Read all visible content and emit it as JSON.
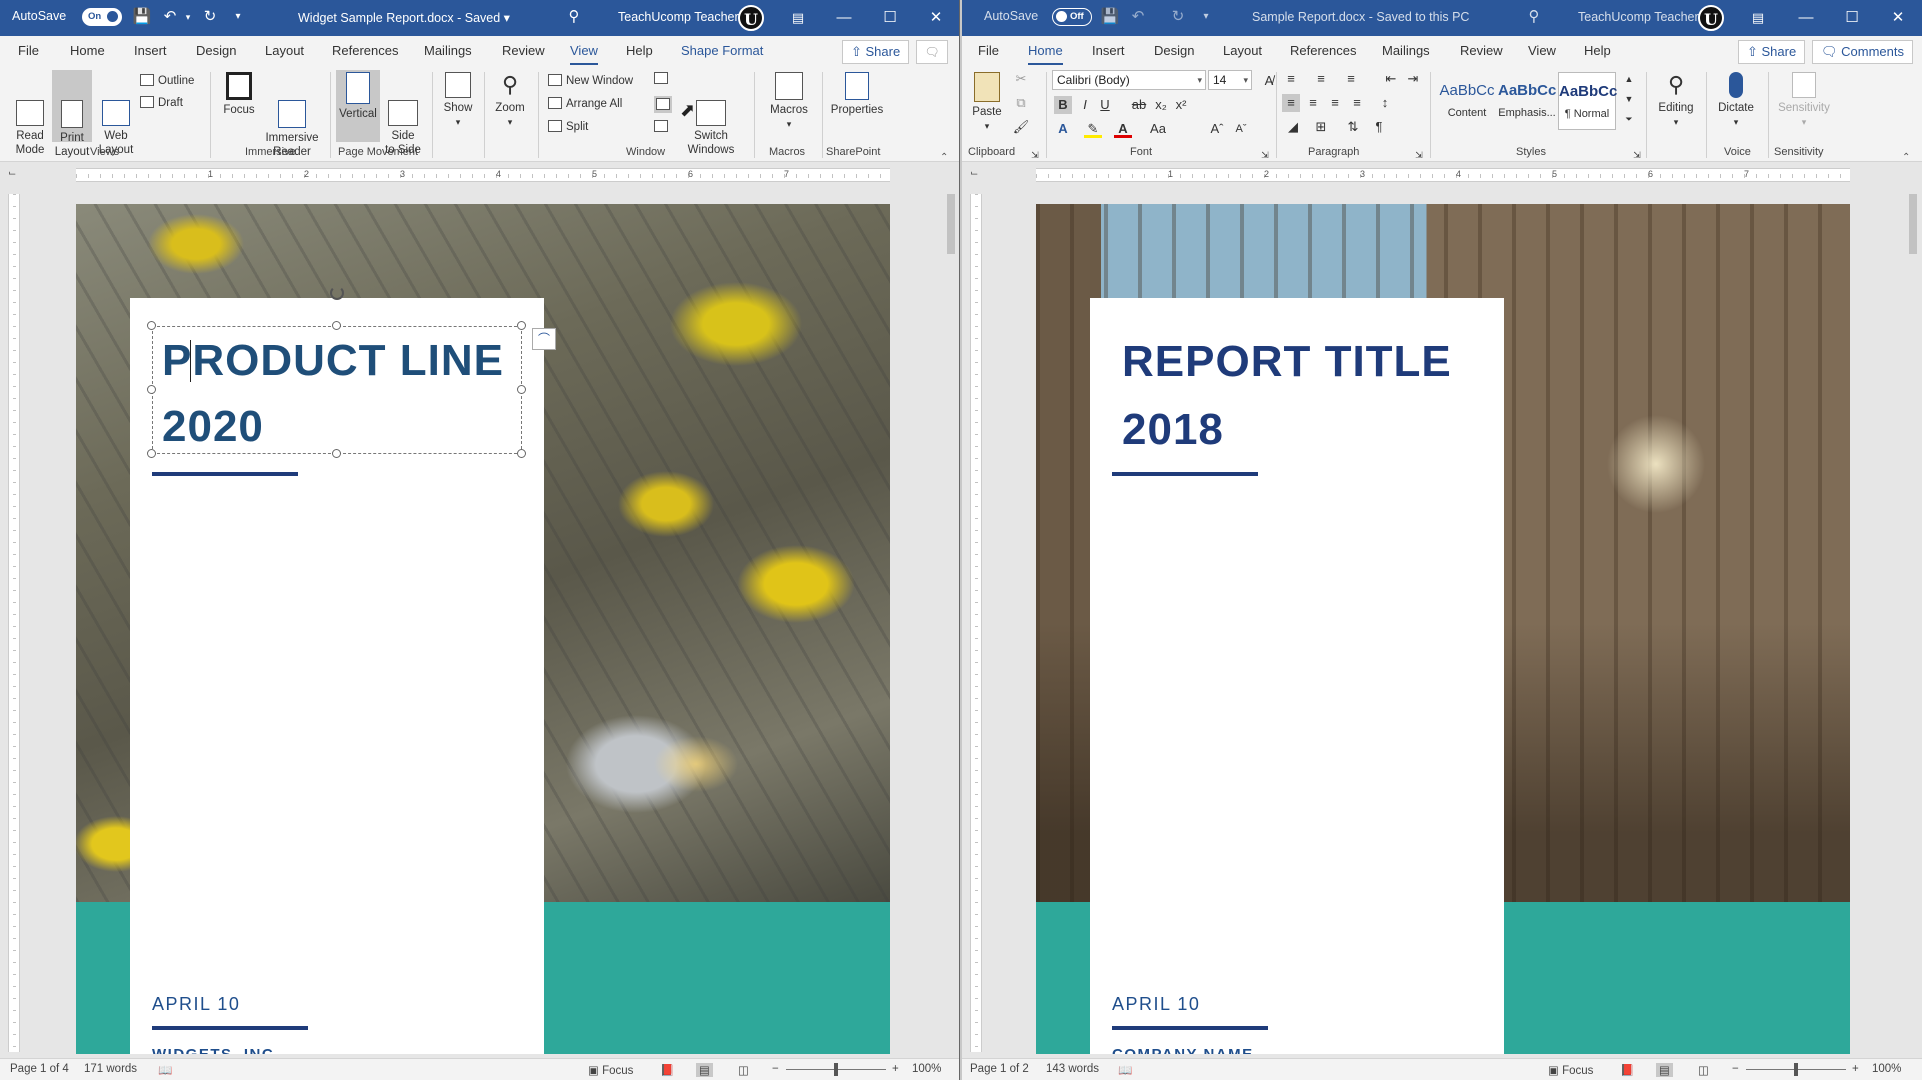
{
  "left": {
    "autosave_label": "AutoSave",
    "autosave_state": "On",
    "doc_title": "Widget Sample Report.docx - Saved",
    "user_name": "TeachUcomp Teacher",
    "avatar_letter": "U",
    "tabs": [
      "File",
      "Home",
      "Insert",
      "Design",
      "Layout",
      "References",
      "Mailings",
      "Review",
      "View",
      "Help",
      "Shape Format"
    ],
    "active_tab": "View",
    "share_label": "Share",
    "ribbon": {
      "views": {
        "read_mode": "Read\nMode",
        "print_layout": "Print\nLayout",
        "web_layout": "Web\nLayout",
        "outline": "Outline",
        "draft": "Draft",
        "label": "Views"
      },
      "immersive": {
        "focus": "Focus",
        "immersive_reader": "Immersive\nReader",
        "label": "Immersive"
      },
      "page_movement": {
        "vertical": "Vertical",
        "side_to_side": "Side\nto Side",
        "label": "Page Movement"
      },
      "show": "Show",
      "zoom": "Zoom",
      "window": {
        "new_window": "New Window",
        "arrange_all": "Arrange All",
        "split": "Split",
        "switch_windows": "Switch\nWindows",
        "label": "Window"
      },
      "macros": {
        "button": "Macros",
        "label": "Macros"
      },
      "sharepoint": {
        "button": "Properties",
        "label": "SharePoint"
      }
    },
    "ruler_numbers": [
      "1",
      "2",
      "3",
      "4",
      "5",
      "6",
      "7"
    ],
    "page": {
      "title_line1": "PRODUCT LINE",
      "title_line2": "2020",
      "date": "APRIL 10",
      "cutoff_text": "WIDGETS, INC."
    },
    "status": {
      "page": "Page 1 of 4",
      "words": "171 words",
      "focus": "Focus",
      "zoom": "100%"
    }
  },
  "right": {
    "autosave_label": "AutoSave",
    "autosave_state": "Off",
    "doc_title": "Sample Report.docx - Saved to this PC",
    "user_name": "TeachUcomp Teacher",
    "avatar_letter": "U",
    "tabs": [
      "File",
      "Home",
      "Insert",
      "Design",
      "Layout",
      "References",
      "Mailings",
      "Review",
      "View",
      "Help"
    ],
    "active_tab": "Home",
    "share_label": "Share",
    "comments_label": "Comments",
    "ribbon": {
      "clipboard": {
        "paste": "Paste",
        "label": "Clipboard"
      },
      "font": {
        "name": "Calibri (Body)",
        "size": "14",
        "label": "Font"
      },
      "paragraph": {
        "label": "Paragraph"
      },
      "styles": {
        "items": [
          {
            "sample": "AaBbCc",
            "name": "Content"
          },
          {
            "sample": "AaBbCc",
            "name": "Emphasis..."
          },
          {
            "sample": "AaBbCc",
            "name": "¶ Normal"
          }
        ],
        "label": "Styles"
      },
      "editing": "Editing",
      "voice": {
        "dictate": "Dictate",
        "label": "Voice"
      },
      "sensitivity": {
        "button": "Sensitivity",
        "label": "Sensitivity"
      }
    },
    "ruler_numbers": [
      "1",
      "2",
      "3",
      "4",
      "5",
      "6",
      "7"
    ],
    "page": {
      "title_line1": "REPORT TITLE",
      "title_line2": "2018",
      "date": "APRIL 10",
      "cutoff_text": "COMPANY NAME"
    },
    "status": {
      "page": "Page 1 of 2",
      "words": "143 words",
      "focus": "Focus",
      "zoom": "100%"
    }
  },
  "colors": {
    "titlebar": "#2b579a",
    "teal_band": "#2ea89a",
    "title_left": "#1f4e79",
    "title_right": "#1f3b7a",
    "accent_bar": "#1f3b7a"
  }
}
